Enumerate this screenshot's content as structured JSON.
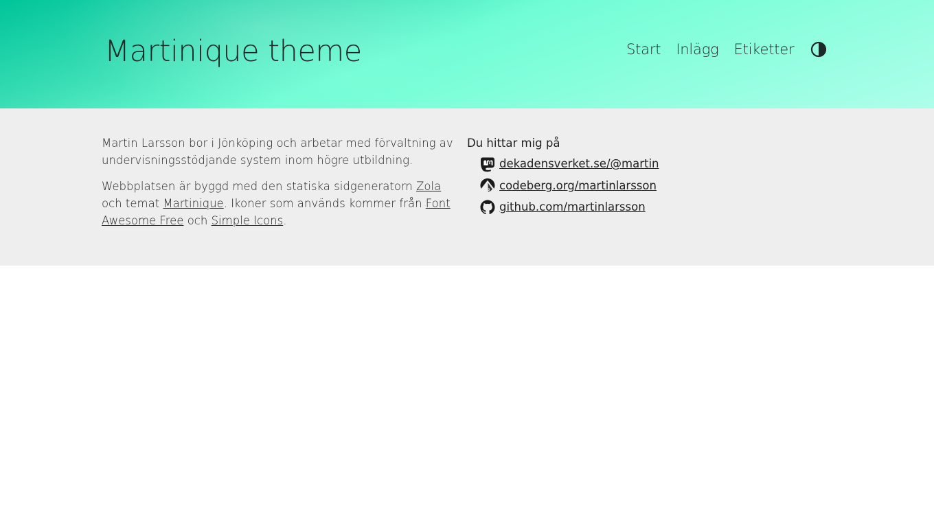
{
  "header": {
    "site_title": "Martinique theme",
    "nav": [
      {
        "label": "Start"
      },
      {
        "label": "Inlägg"
      },
      {
        "label": "Etiketter"
      }
    ],
    "theme_toggle_icon": "contrast-icon"
  },
  "about": {
    "p1": "Martin Larsson bor i Jönköping och arbetar med förvaltning av undervisningsstödjande system inom högre utbildning.",
    "p2": {
      "t1": "Webbplatsen är byggd med den statiska sidgeneratorn ",
      "link_zola": "Zola",
      "t2": " och temat ",
      "link_martinique": "Martinique",
      "t3": ". Ikoner som används kommer från ",
      "link_fa": "Font Awesome Free",
      "t4": " och ",
      "link_si": "Simple Icons",
      "t5": "."
    }
  },
  "find_me": {
    "heading": "Du hittar mig på",
    "links": [
      {
        "icon": "mastodon-icon",
        "label": "dekadensverket.se/@martin"
      },
      {
        "icon": "codeberg-icon",
        "label": "codeberg.org/martinlarsson"
      },
      {
        "icon": "github-icon",
        "label": "github.com/martinlarsson"
      }
    ]
  },
  "colors": {
    "header_gradient_start": "#00c49a",
    "header_gradient_end": "#aefeea",
    "content_background": "#eeeeee",
    "text": "#222222"
  }
}
